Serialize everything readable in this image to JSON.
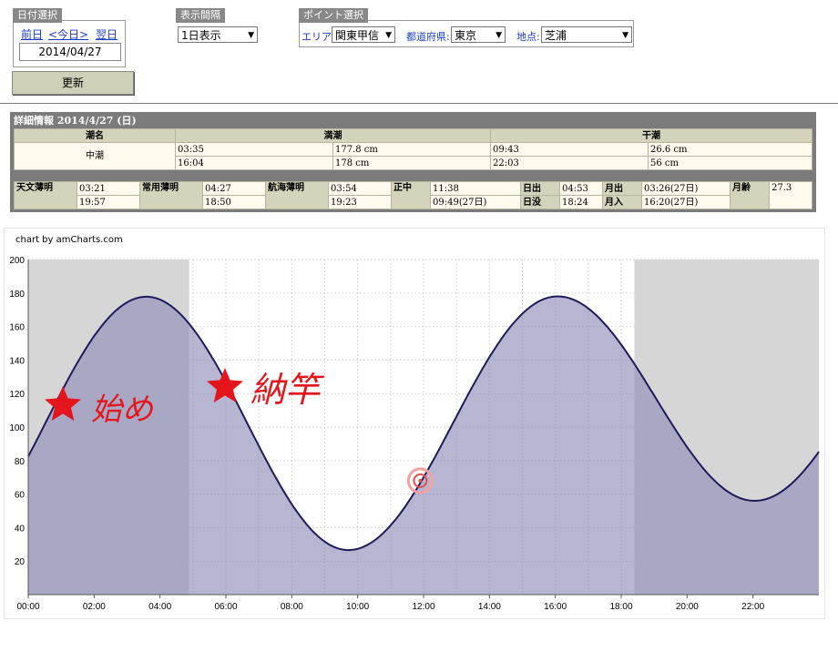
{
  "date_panel": {
    "label": "日付選択",
    "prev": "前日",
    "today": "<今日>",
    "next": "翌日",
    "date_value": "2014/04/27"
  },
  "interval_panel": {
    "label": "表示間隔",
    "selected": "1日表示"
  },
  "point_panel": {
    "label": "ポイント選択",
    "area_label": "エリア:",
    "area_value": "関東甲信",
    "pref_label": "都道府県:",
    "pref_value": "東京",
    "spot_label": "地点:",
    "spot_value": "芝浦"
  },
  "update_button": "更新",
  "detail": {
    "title": "詳細情報  2014/4/27 (日)",
    "tide_header": {
      "name": "潮名",
      "high": "満潮",
      "low": "干潮"
    },
    "tide_name": "中潮",
    "high_tides": [
      {
        "time": "03:35",
        "height": "177.8 cm"
      },
      {
        "time": "16:04",
        "height": "178 cm"
      }
    ],
    "low_tides": [
      {
        "time": "09:43",
        "height": "26.6 cm"
      },
      {
        "time": "22:03",
        "height": "56 cm"
      }
    ],
    "astro": {
      "astronomical_twilight_label": "天文薄明",
      "astronomical_twilight": [
        "03:21",
        "19:57"
      ],
      "civil_twilight_label": "常用薄明",
      "civil_twilight": [
        "04:27",
        "18:50"
      ],
      "nautical_twilight_label": "航海薄明",
      "nautical_twilight": [
        "03:54",
        "19:23"
      ],
      "transit_label": "正中",
      "transit": [
        "11:38",
        "09:49(27日)"
      ],
      "sunrise_label": "日出",
      "sunrise": "04:53",
      "sunset_label": "日没",
      "sunset": "18:24",
      "moonrise_label": "月出",
      "moonrise": "03:26(27日)",
      "moonset_label": "月入",
      "moonset": "16:20(27日)",
      "moon_age_label": "月齢",
      "moon_age": "27.3"
    }
  },
  "chart_credit": "chart by amCharts.com",
  "annotations": {
    "start": "始め",
    "end": "納竿"
  },
  "colors": {
    "fill": "#8f8fbc",
    "line": "#1c1c5a",
    "night_band": "#c8c8c8",
    "annotation": "#e4151c"
  },
  "chart_data": {
    "type": "area",
    "xlabel": "",
    "ylabel": "",
    "xlim": [
      0,
      24
    ],
    "ylim": [
      0,
      200
    ],
    "grid": true,
    "x_ticks": [
      "00:00",
      "02:00",
      "04:00",
      "06:00",
      "08:00",
      "10:00",
      "12:00",
      "14:00",
      "16:00",
      "18:00",
      "20:00",
      "22:00"
    ],
    "y_ticks": [
      20,
      40,
      60,
      80,
      100,
      120,
      140,
      160,
      180,
      200
    ],
    "extremes": [
      {
        "x": 3.583,
        "y": 177.8
      },
      {
        "x": 9.717,
        "y": 26.6
      },
      {
        "x": 16.067,
        "y": 178
      },
      {
        "x": 22.05,
        "y": 56
      }
    ],
    "start_value": 102,
    "end_value": 82,
    "night_bands": [
      [
        0,
        4.883
      ],
      [
        18.4,
        24
      ]
    ],
    "marker": {
      "x": 11.9,
      "y": 68
    }
  }
}
